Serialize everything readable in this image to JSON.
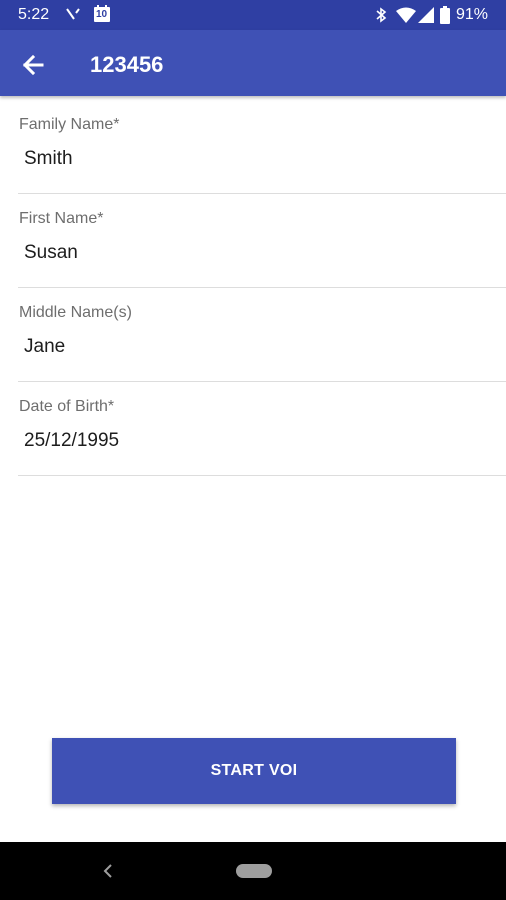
{
  "status_bar": {
    "time": "5:22",
    "battery_percent": "91%",
    "calendar_date": "10",
    "icons": [
      "missed-call-icon",
      "calendar-icon",
      "bluetooth-icon",
      "wifi-icon",
      "signal-icon",
      "battery-icon"
    ]
  },
  "app_bar": {
    "back_icon": "arrow-back-icon",
    "title": "123456"
  },
  "form": {
    "fields": [
      {
        "label": "Family Name*",
        "value": "Smith"
      },
      {
        "label": "First Name*",
        "value": "Susan"
      },
      {
        "label": "Middle Name(s)",
        "value": "Jane"
      },
      {
        "label": "Date of Birth*",
        "value": "25/12/1995"
      }
    ]
  },
  "start_button": {
    "label": "START VOI"
  },
  "nav_bar": {
    "back_icon": "nav-back-icon",
    "home_icon": "nav-home-pill-icon"
  },
  "colors": {
    "primary": "#3f51b5",
    "status_bar": "#2f3fa3",
    "nav_bar": "#000000"
  }
}
